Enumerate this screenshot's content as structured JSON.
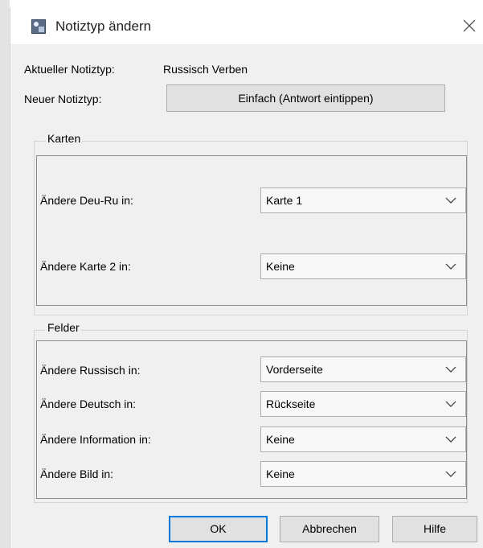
{
  "dialog": {
    "title": "Notiztyp ändern",
    "icon": "anki-app-icon",
    "close_glyph": "╳"
  },
  "current": {
    "label": "Aktueller Notiztyp:",
    "value": "Russisch Verben"
  },
  "new": {
    "label": "Neuer Notiztyp:",
    "button": "Einfach (Antwort eintippen)"
  },
  "cards": {
    "title": "Karten",
    "rows": [
      {
        "label": "Ändere Deu-Ru in:",
        "value": "Karte 1"
      },
      {
        "label": "Ändere Karte 2 in:",
        "value": "Keine"
      }
    ]
  },
  "fields": {
    "title": "Felder",
    "rows": [
      {
        "label": "Ändere Russisch in:",
        "value": "Vorderseite"
      },
      {
        "label": "Ändere Deutsch in:",
        "value": "Rückseite"
      },
      {
        "label": "Ändere Information in:",
        "value": "Keine"
      },
      {
        "label": "Ändere Bild in:",
        "value": "Keine"
      }
    ]
  },
  "buttons": {
    "ok": "OK",
    "cancel": "Abbrechen",
    "help": "Hilfe"
  },
  "colors": {
    "accent": "#0078d7",
    "background": "#f0f0f0",
    "button": "#e1e1e1"
  }
}
